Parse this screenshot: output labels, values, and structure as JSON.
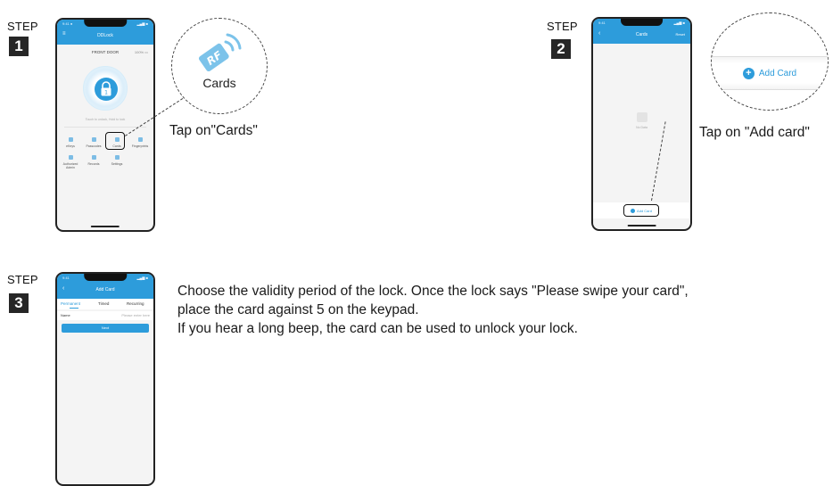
{
  "steps": [
    {
      "label": "STEP",
      "number": "1",
      "caption": "Tap on\"Cards\"",
      "zoom_label": "Cards",
      "rf_icon_text": "RF",
      "phone": {
        "status_left": "9:41 ●",
        "status_right": "▂▄▆ ■",
        "title": "DDLock",
        "lock_name": "FRONT DOOR",
        "battery": "100% ▭",
        "lock_badge": "1",
        "hint": "Touch to unlock, Hold to lock",
        "menu_items": [
          {
            "label": "eKeys",
            "icon": "ekey-icon"
          },
          {
            "label": "Passcodes",
            "icon": "passcode-icon"
          },
          {
            "label": "Cards",
            "icon": "card-icon"
          },
          {
            "label": "Fingerprints",
            "icon": "fingerprint-icon"
          },
          {
            "label": "Authorized Admin",
            "icon": "admin-icon"
          },
          {
            "label": "Records",
            "icon": "records-icon"
          },
          {
            "label": "Settings",
            "icon": "settings-icon"
          }
        ]
      }
    },
    {
      "label": "STEP",
      "number": "2",
      "caption": "Tap on \"Add card\"",
      "zoom_label": "Add Card",
      "phone": {
        "status_left": "9:41",
        "status_right": "▂▄▆ ■",
        "title": "Cards",
        "header_right": "Reset",
        "empty_text": "No Data",
        "add_button": "Add Card"
      }
    },
    {
      "label": "STEP",
      "number": "3",
      "instructions": [
        "Choose the validity period of the lock. Once the lock says \"Please swipe your card\",",
        "place the card against 5 on the keypad.",
        "If you hear a long beep, the card can be used to unlock your lock."
      ],
      "phone": {
        "status_left": "9:41",
        "status_right": "▂▄▆ ■",
        "title": "Add Card",
        "tabs": [
          "Permanent",
          "Timed",
          "Recurring"
        ],
        "name_label": "Name",
        "name_placeholder": "Please enter here",
        "next_button": "Next"
      }
    }
  ]
}
